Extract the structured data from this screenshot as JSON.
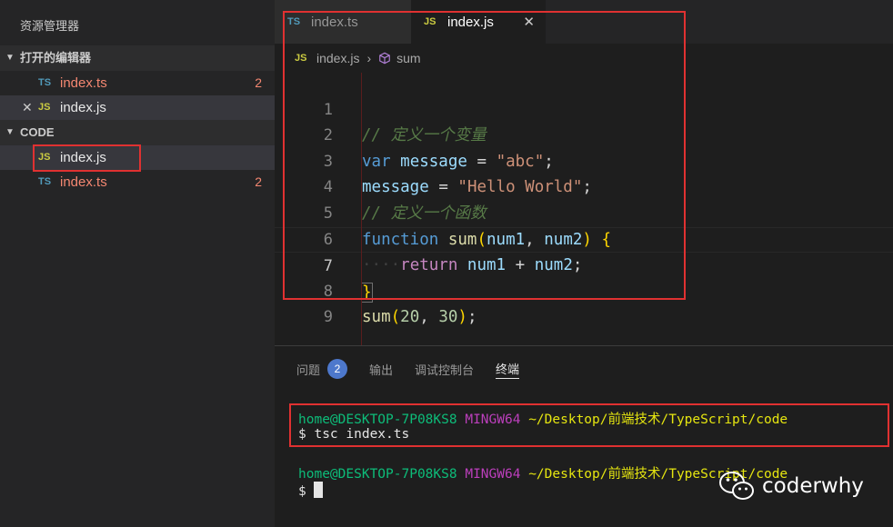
{
  "sidebar": {
    "title": "资源管理器",
    "open_editors_label": "打开的编辑器",
    "open_editors": [
      {
        "name": "index.ts",
        "icon": "TS",
        "error_count": "2"
      },
      {
        "name": "index.js",
        "icon": "JS"
      }
    ],
    "folder_label": "CODE",
    "files": [
      {
        "name": "index.js",
        "icon": "JS"
      },
      {
        "name": "index.ts",
        "icon": "TS",
        "error_count": "2"
      }
    ]
  },
  "tabs": [
    {
      "label": "index.ts",
      "icon": "TS"
    },
    {
      "label": "index.js",
      "icon": "JS",
      "active": true
    }
  ],
  "breadcrumb": {
    "icon": "JS",
    "file": "index.js",
    "symbol": "sum"
  },
  "code": {
    "line_numbers": [
      "1",
      "2",
      "3",
      "4",
      "5",
      "6",
      "7",
      "8",
      "9"
    ],
    "current_line": "7",
    "tokens": {
      "l1_comment": "// 定义一个变量",
      "kw_var": "var",
      "v_message": "message",
      "op_eq": "=",
      "s_abc": "\"abc\"",
      "semi": ";",
      "s_hello": "\"Hello World\"",
      "l4_comment": "// 定义一个函数",
      "kw_function": "function",
      "fn_sum": "sum",
      "p_open": "(",
      "p_num1": "num1",
      "comma": ",",
      "p_num2": "num2",
      "p_close": ")",
      "brace_open": "{",
      "indent_dots": "····",
      "kw_return": "return",
      "op_plus": "+",
      "brace_close": "}",
      "n_20": "20",
      "n_30": "30"
    }
  },
  "panel": {
    "tabs": [
      "问题",
      "输出",
      "调试控制台",
      "终端"
    ],
    "problems_count": "2",
    "active_tab": "终端"
  },
  "terminal": {
    "user": "home@DESKTOP-7P08KS8",
    "env": "MINGW64",
    "path": "~/Desktop/前端技术/TypeScript/code",
    "prompt": "$",
    "command": "tsc index.ts"
  },
  "watermark": {
    "text": "coderwhy"
  },
  "colors": {
    "highlight": "#e03131",
    "badge": "#4d78cc"
  }
}
